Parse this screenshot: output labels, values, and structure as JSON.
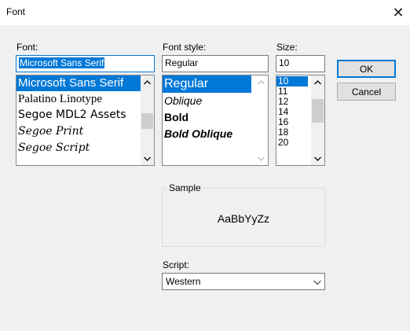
{
  "window": {
    "title": "Font",
    "close_symbol": "✕"
  },
  "font": {
    "label": "Font:",
    "value": "Microsoft Sans Serif",
    "items": [
      "Microsoft Sans Serif",
      "Palatino Linotype",
      "Segoe MDL2 Assets",
      "Segoe Print",
      "Segoe Script"
    ]
  },
  "style": {
    "label": "Font style:",
    "value": "Regular",
    "items": [
      "Regular",
      "Oblique",
      "Bold",
      "Bold Oblique"
    ]
  },
  "size": {
    "label": "Size:",
    "value": "10",
    "items": [
      "10",
      "11",
      "12",
      "14",
      "16",
      "18",
      "20"
    ]
  },
  "buttons": {
    "ok": "OK",
    "cancel": "Cancel"
  },
  "sample": {
    "label": "Sample",
    "text": "AaBbYyZz"
  },
  "script": {
    "label": "Script:",
    "value": "Western"
  },
  "colors": {
    "accent": "#0078d7"
  }
}
